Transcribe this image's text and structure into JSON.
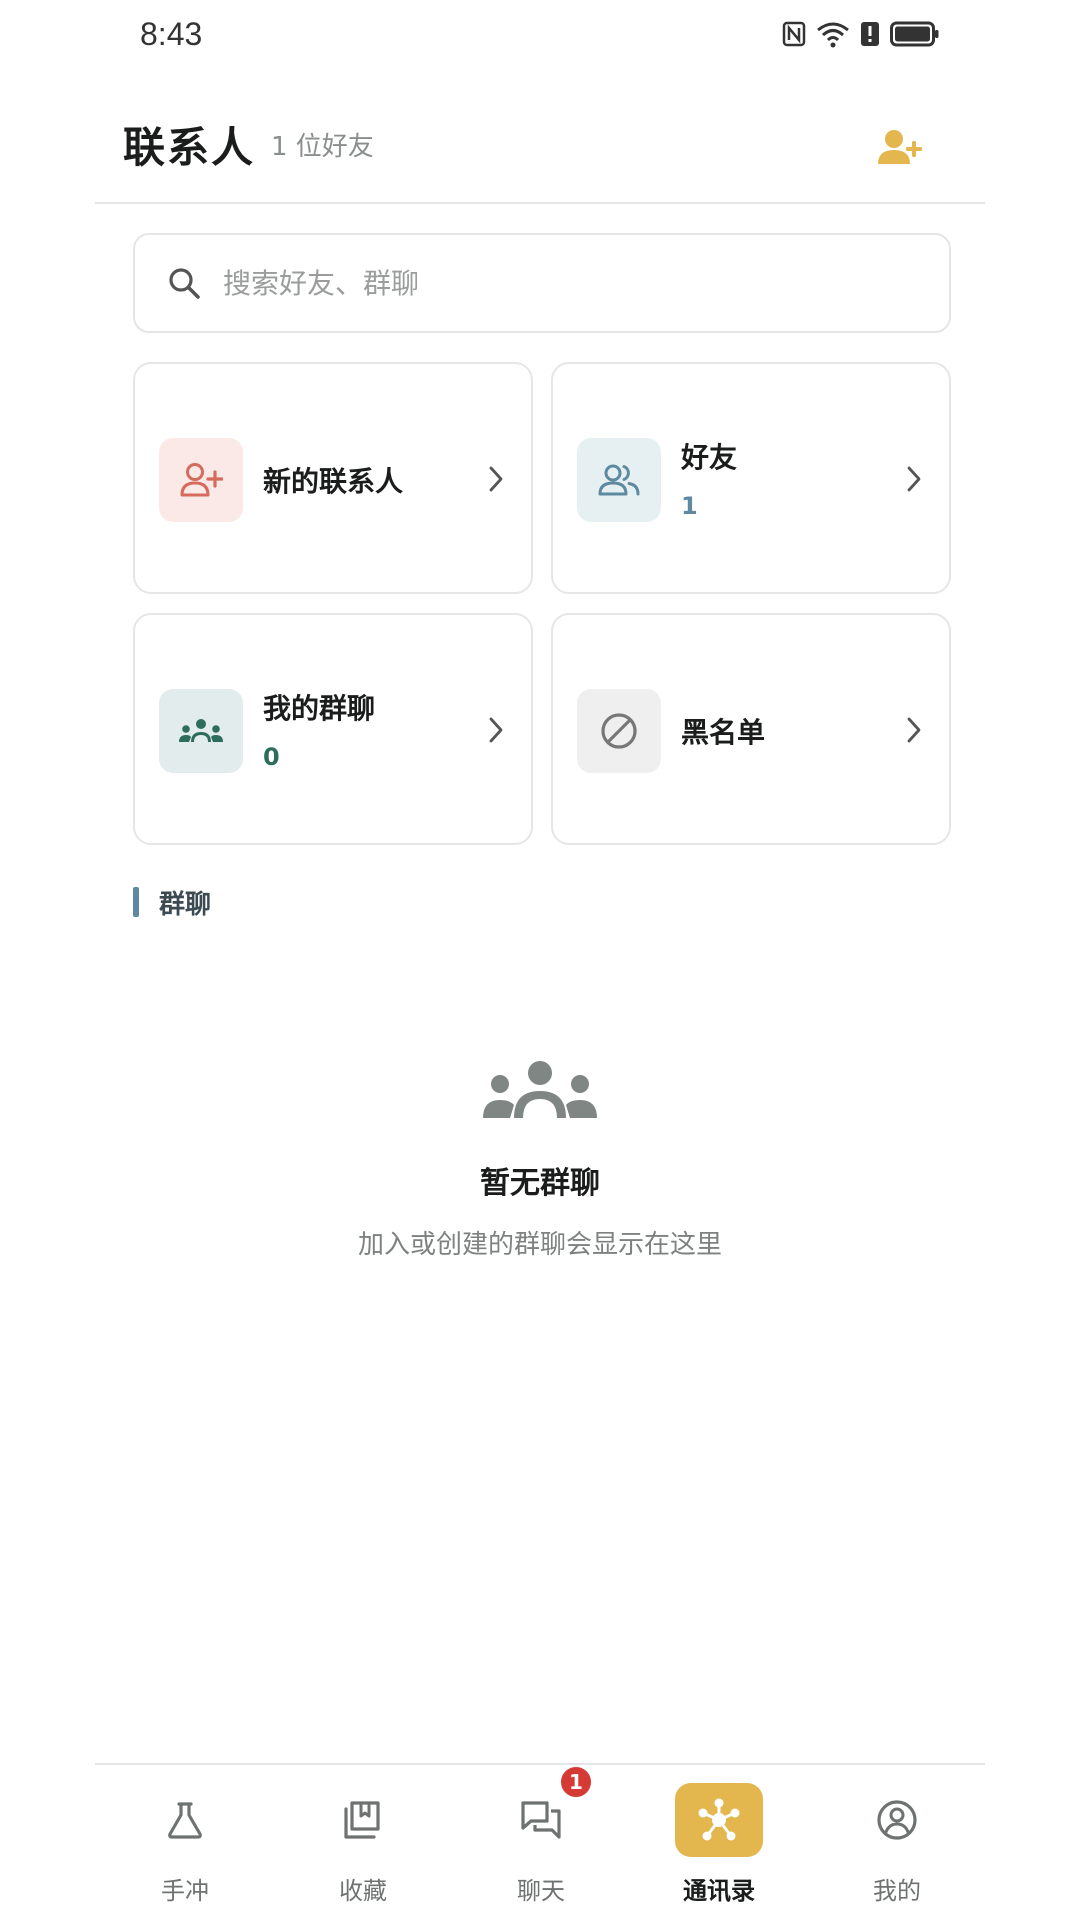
{
  "status_bar": {
    "time": "8:43"
  },
  "header": {
    "title": "联系人",
    "friend_count": "1 位好友",
    "add_icon": "add-user-icon"
  },
  "search": {
    "placeholder": "搜索好友、群聊",
    "value": ""
  },
  "cards": {
    "new_contacts": {
      "label": "新的联系人",
      "icon": "add-user-icon",
      "icon_bg": "#fbe9e7",
      "icon_color": "#d66a5c"
    },
    "friends": {
      "label": "好友",
      "count": "1",
      "icon": "users-icon",
      "icon_bg": "#e6f0f3",
      "icon_color": "#5d8aa0"
    },
    "my_groups": {
      "label": "我的群聊",
      "count": "0",
      "icon": "group-icon",
      "icon_bg": "#e3ecec",
      "icon_color": "#2e6d5e"
    },
    "blacklist": {
      "label": "黑名单",
      "icon": "block-icon",
      "icon_bg": "#efefef",
      "icon_color": "#777"
    }
  },
  "section": {
    "group_chats": "群聊"
  },
  "empty_state": {
    "title": "暂无群聊",
    "description": "加入或创建的群聊会显示在这里"
  },
  "bottom_nav": {
    "items": [
      {
        "label": "手冲",
        "icon": "flask-icon"
      },
      {
        "label": "收藏",
        "icon": "bookmark-icon"
      },
      {
        "label": "聊天",
        "icon": "chat-icon",
        "badge": "1"
      },
      {
        "label": "通讯录",
        "icon": "network-icon",
        "active": true
      },
      {
        "label": "我的",
        "icon": "user-circle-icon"
      }
    ]
  },
  "colors": {
    "accent": "#e3b64e",
    "badge": "#d63a35",
    "section_bar": "#5d8aa0"
  }
}
